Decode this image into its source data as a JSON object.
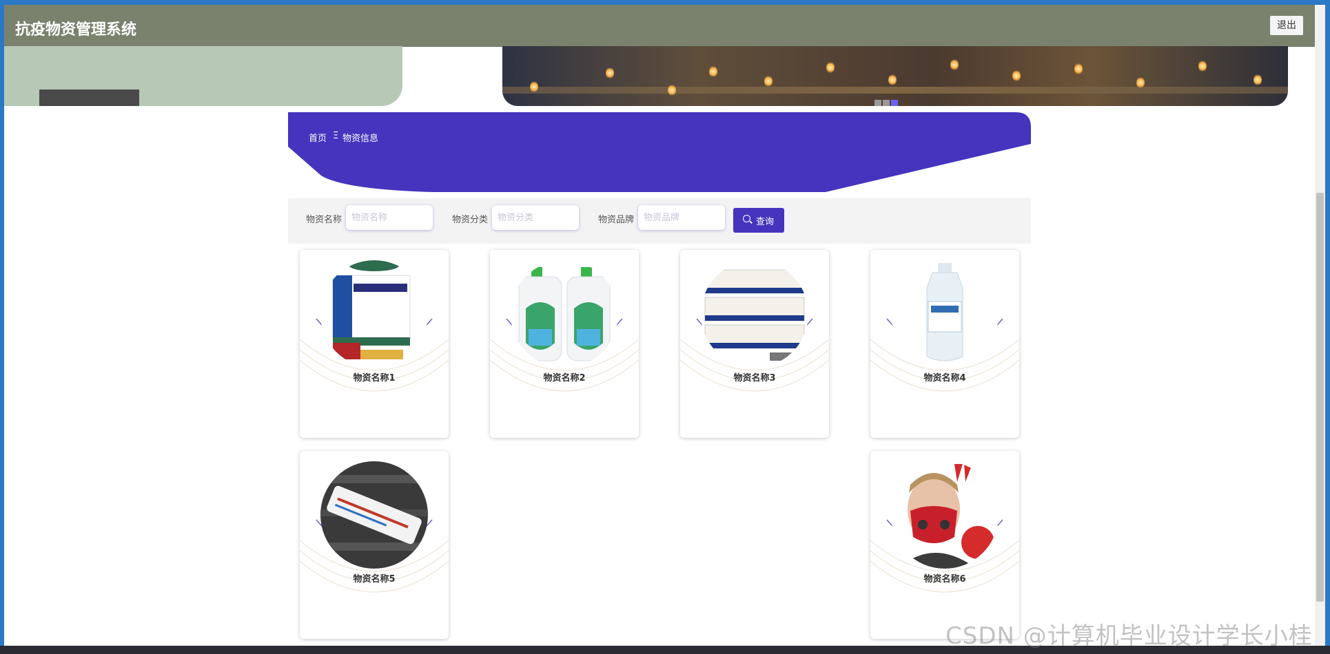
{
  "header": {
    "title": "抗疫物资管理系统",
    "logout_label": "退出"
  },
  "breadcrumb": {
    "home": "首页",
    "separator": "Ξ",
    "current": "物资信息"
  },
  "search": {
    "fields": [
      {
        "label": "物资名称",
        "placeholder": "物资名称"
      },
      {
        "label": "物资分类",
        "placeholder": "物资分类"
      },
      {
        "label": "物资品牌",
        "placeholder": "物资品牌"
      }
    ],
    "button_label": "查询"
  },
  "items": [
    {
      "name": "物资名称1",
      "image": "lianhua-capsule-box"
    },
    {
      "name": "物资名称2",
      "image": "disinfectant-bottles"
    },
    {
      "name": "物资名称3",
      "image": "medicine-tablet-box"
    },
    {
      "name": "物资名称4",
      "image": "alcohol-bottle"
    },
    {
      "name": "物资名称5",
      "image": "thermometer"
    },
    {
      "name": "物资名称6",
      "image": "man-with-red-mask"
    }
  ],
  "watermark": "CSDN @计算机毕业设计学长小桂",
  "colors": {
    "header_bg": "#7a826e",
    "accent": "#4634be",
    "frame": "#2b78c5"
  }
}
